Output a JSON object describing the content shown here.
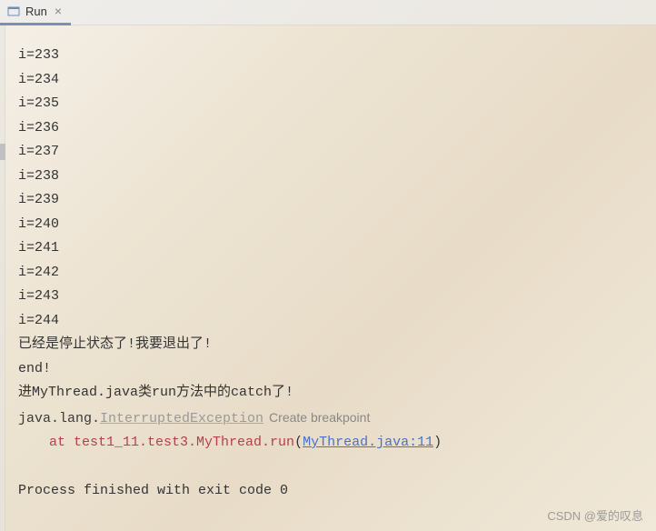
{
  "tab": {
    "label": "Run",
    "close": "×"
  },
  "console": {
    "lines": [
      "i=233",
      "i=234",
      "i=235",
      "i=236",
      "i=237",
      "i=238",
      "i=239",
      "i=240",
      "i=241",
      "i=242",
      "i=243",
      "i=244",
      "已经是停止状态了!我要退出了!",
      "end!",
      "进MyThread.java类run方法中的catch了!"
    ],
    "exception": {
      "prefix": "java.lang.",
      "class": "InterruptedException",
      "breakpoint_label": "Create breakpoint"
    },
    "stack": {
      "at": "at ",
      "location": "test1_11.test3.MyThread.run",
      "file": "MyThread.java:11"
    },
    "exit": "Process finished with exit code 0"
  },
  "watermark": "CSDN @爱的叹息"
}
